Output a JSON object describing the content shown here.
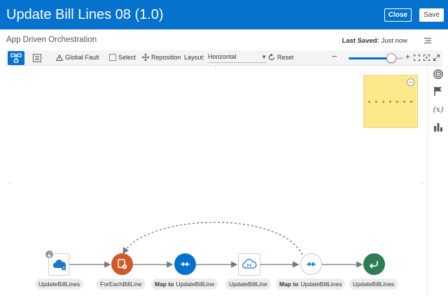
{
  "header": {
    "title": "Update Bill Lines 08 (1.0)",
    "close_label": "Close",
    "save_label": "Save"
  },
  "subheader": {
    "subtitle": "App Driven Orchestration",
    "last_saved_label": "Last Saved:",
    "last_saved_value": "Just now"
  },
  "toolbar": {
    "global_fault": "Global Fault",
    "select": "Select",
    "reposition": "Reposition",
    "layout_label": "Layout:",
    "layout_value": "Horizontal",
    "reset": "Reset",
    "zoom_level": 0.78
  },
  "nodes": [
    {
      "label": "UpdateBillLines",
      "icon": "rest-trigger-icon"
    },
    {
      "label": "ForEachBillLine",
      "icon": "for-each-icon"
    },
    {
      "prefix": "Map to",
      "label": "UpdateBillLine",
      "icon": "map-icon"
    },
    {
      "label": "UpdateBillLine",
      "icon": "invoke-cloud-icon"
    },
    {
      "prefix": "Map to",
      "label": "UpdateBillLines",
      "icon": "map-icon"
    },
    {
      "label": "UpdateBillLines",
      "icon": "return-icon"
    }
  ],
  "colors": {
    "header_blue": "#0572ce",
    "foreach_orange": "#d05a2e",
    "map_blue": "#0572ce",
    "return_green": "#2e7d56",
    "minimap_yellow": "#fce98c"
  },
  "rail_icons": [
    "target-icon",
    "flag-icon",
    "variable-icon",
    "chart-icon"
  ]
}
